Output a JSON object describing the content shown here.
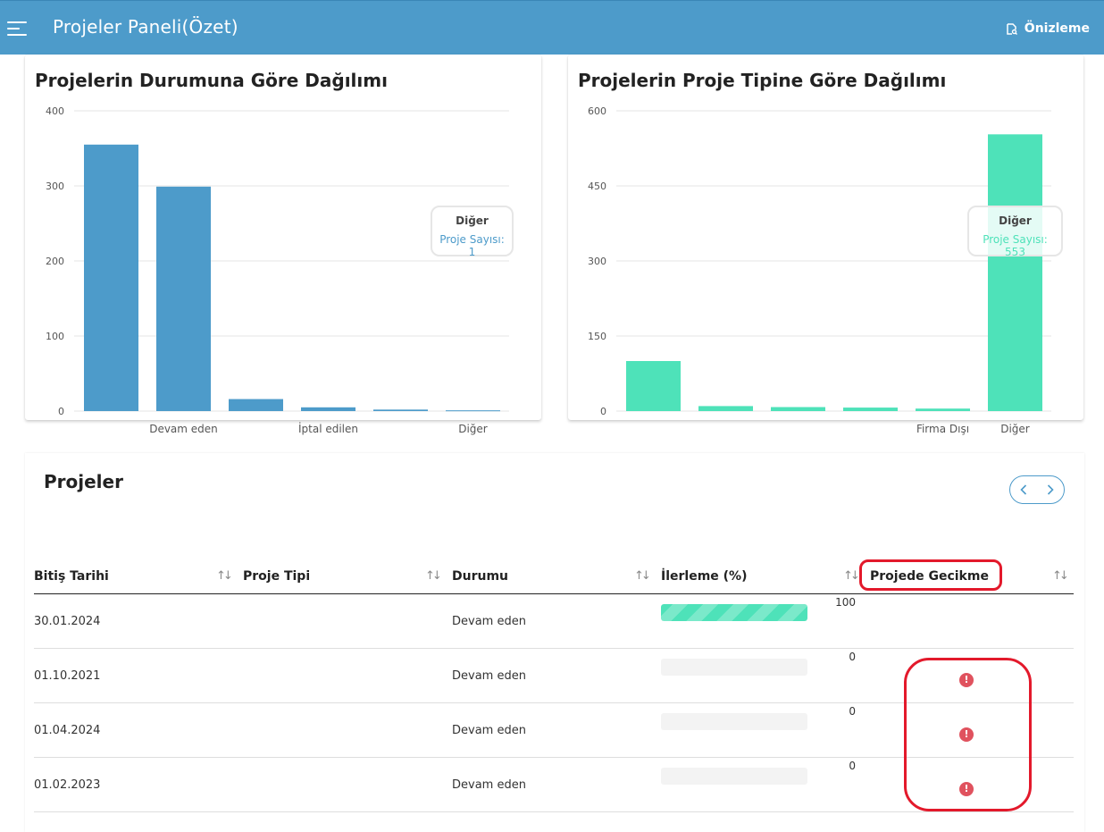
{
  "header": {
    "title": "Projeler Paneli(Özet)",
    "preview_label": "Önizleme"
  },
  "charts": {
    "status": {
      "title": "Projelerin Durumuna Göre Dağılımı",
      "color": "#4d9bca",
      "tooltip": {
        "title": "Diğer",
        "value": "Proje Sayısı: 1"
      }
    },
    "type": {
      "title": "Projelerin Proje Tipine Göre Dağılımı",
      "color": "#4ee2b9",
      "tooltip": {
        "title": "Diğer",
        "value": "Proje Sayısı: 553"
      }
    }
  },
  "chart_data": [
    {
      "type": "bar",
      "title": "Projelerin Durumuna Göre Dağılımı",
      "categories": [
        "",
        "Devam eden",
        "",
        "İptal edilen",
        "",
        "Diğer"
      ],
      "category_labels_shown": [
        "Devam eden",
        "İptal edilen",
        "Diğer"
      ],
      "values": [
        355,
        299,
        16,
        5,
        2,
        1
      ],
      "series_label": "Proje Sayısı",
      "ylim": [
        0,
        400
      ],
      "yticks": [
        0,
        100,
        200,
        300,
        400
      ],
      "grid": true,
      "color": "#4d9bca"
    },
    {
      "type": "bar",
      "title": "Projelerin Proje Tipine Göre Dağılımı",
      "categories": [
        "",
        "",
        "",
        "",
        "Firma Dışı",
        "Diğer"
      ],
      "category_labels_shown": [
        "Firma Dışı",
        "Diğer"
      ],
      "values": [
        100,
        10,
        8,
        7,
        5,
        553
      ],
      "series_label": "Proje Sayısı",
      "ylim": [
        0,
        600
      ],
      "yticks": [
        0,
        150,
        300,
        450,
        600
      ],
      "grid": true,
      "color": "#4ee2b9"
    }
  ],
  "table": {
    "title": "Projeler",
    "columns": [
      "Bitiş Tarihi",
      "Proje Tipi",
      "Durumu",
      "İlerleme (%)",
      "Projede Gecikme"
    ],
    "rows": [
      {
        "end_date": "30.01.2024",
        "project_type": "",
        "status": "Devam eden",
        "progress": 100,
        "progress_label": "100",
        "delayed": false
      },
      {
        "end_date": "01.10.2021",
        "project_type": "",
        "status": "Devam eden",
        "progress": 0,
        "progress_label": "0",
        "delayed": true
      },
      {
        "end_date": "01.04.2024",
        "project_type": "",
        "status": "Devam eden",
        "progress": 0,
        "progress_label": "0",
        "delayed": true
      },
      {
        "end_date": "01.02.2023",
        "project_type": "",
        "status": "Devam eden",
        "progress": 0,
        "progress_label": "0",
        "delayed": true
      }
    ]
  }
}
